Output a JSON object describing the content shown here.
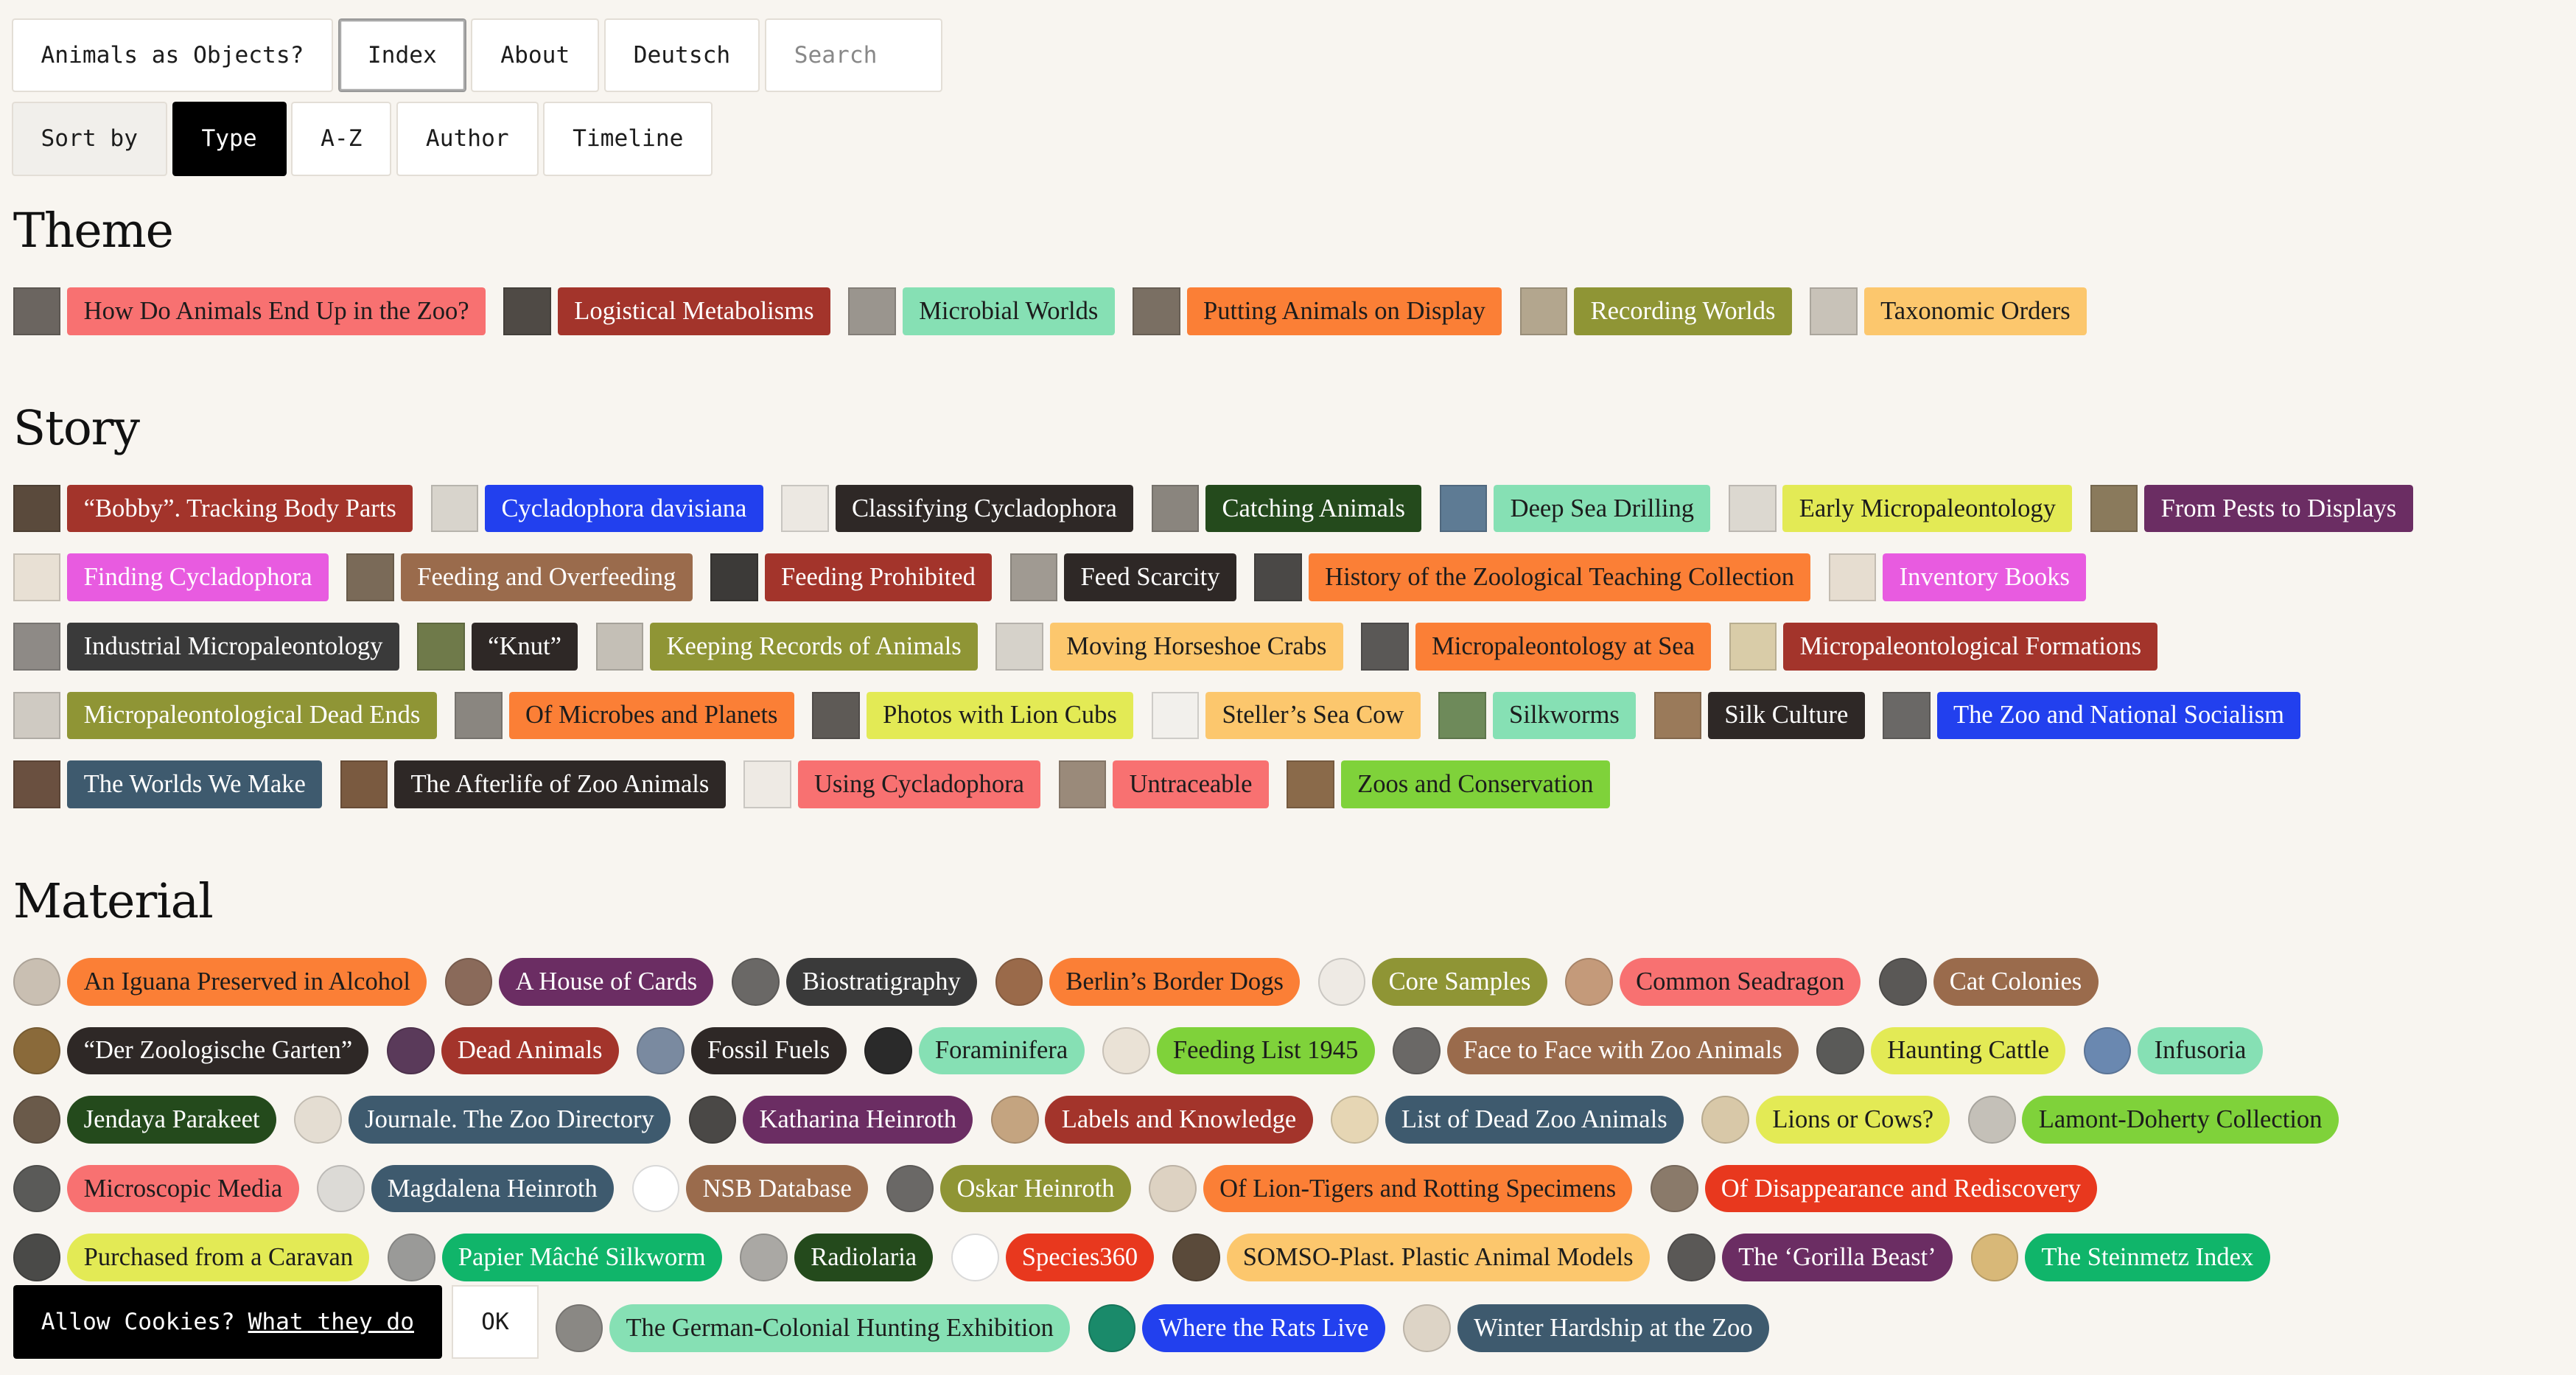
{
  "nav": {
    "home": "Animals as Objects?",
    "index": "Index",
    "about": "About",
    "lang": "Deutsch",
    "search_placeholder": "Search"
  },
  "sort": {
    "label": "Sort by",
    "options": [
      "Type",
      "A-Z",
      "Author",
      "Timeline"
    ],
    "selected": "Type"
  },
  "sections": [
    {
      "title": "Theme",
      "kind": "theme",
      "rows": [
        [
          {
            "label": "How Do Animals End Up in the Zoo?",
            "color": "#f87171",
            "thumb": "#6b6560"
          },
          {
            "label": "Logistical Metabolisms",
            "color": "#a3342b",
            "thumb": "#4f4a45"
          },
          {
            "label": "Microbial Worlds",
            "color": "#86e0b4",
            "thumb": "#9a958e"
          },
          {
            "label": "Putting Animals on Display",
            "color": "#fb7f36",
            "thumb": "#7a6f63"
          },
          {
            "label": "Recording Worlds",
            "color": "#8f9535",
            "thumb": "#b3a68e"
          },
          {
            "label": "Taxonomic Orders",
            "color": "#fcc76d",
            "thumb": "#c8c2b8"
          }
        ]
      ]
    },
    {
      "title": "Story",
      "kind": "story",
      "rows": [
        [
          {
            "label": "“Bobby”. Tracking Body Parts",
            "color": "#a3342b",
            "thumb": "#5a4a3c"
          },
          {
            "label": "Cycladophora davisiana",
            "color": "#2240ee",
            "thumb": "#d8d4cc"
          },
          {
            "label": "Classifying Cycladophora",
            "color": "#2e2826",
            "thumb": "#ece8e2"
          },
          {
            "label": "Catching Animals",
            "color": "#244a1c",
            "thumb": "#8a857e"
          },
          {
            "label": "Deep Sea Drilling",
            "color": "#86e0b4",
            "thumb": "#5e7b94"
          },
          {
            "label": "Early Micropaleontology",
            "color": "#e3ea55",
            "thumb": "#dcd8d0"
          },
          {
            "label": "From Pests to Displays",
            "color": "#6b2d63",
            "thumb": "#8a7a5c"
          }
        ],
        [
          {
            "label": "Finding Cycladophora",
            "color": "#e85be0",
            "thumb": "#e8e0d4"
          },
          {
            "label": "Feeding and Overfeeding",
            "color": "#9a6b4c",
            "thumb": "#7a6a58"
          },
          {
            "label": "Feeding Prohibited",
            "color": "#a3342b",
            "thumb": "#3c3a38"
          },
          {
            "label": "Feed Scarcity",
            "color": "#2e2826",
            "thumb": "#a09a92"
          },
          {
            "label": "History of the Zoological Teaching Collection",
            "color": "#fb7f36",
            "thumb": "#4a4846"
          },
          {
            "label": "Inventory Books",
            "color": "#e85be0",
            "thumb": "#e6ddd0"
          }
        ],
        [
          {
            "label": "Industrial Micropaleontology",
            "color": "#3a3a3a",
            "thumb": "#8e8a86"
          },
          {
            "label": "“Knut”",
            "color": "#2e2826",
            "thumb": "#6f7a4a"
          },
          {
            "label": "Keeping Records of Animals",
            "color": "#8f9535",
            "thumb": "#c4bfb6"
          },
          {
            "label": "Moving Horseshoe Crabs",
            "color": "#fcc76d",
            "thumb": "#d6d2ca"
          },
          {
            "label": "Micropaleontology at Sea",
            "color": "#fb7f36",
            "thumb": "#5a5856"
          },
          {
            "label": "Micropaleontological Formations",
            "color": "#a3342b",
            "thumb": "#d9cca8"
          }
        ],
        [
          {
            "label": "Micropaleontological Dead Ends",
            "color": "#8f9535",
            "thumb": "#cfcac2"
          },
          {
            "label": "Of Microbes and Planets",
            "color": "#fb7f36",
            "thumb": "#8a8680"
          },
          {
            "label": "Photos with Lion Cubs",
            "color": "#e3ea55",
            "thumb": "#5e5a56"
          },
          {
            "label": "Steller’s Sea Cow",
            "color": "#fcc76d",
            "thumb": "#f2f0ec"
          },
          {
            "label": "Silkworms",
            "color": "#86e0b4",
            "thumb": "#6e8a5a"
          },
          {
            "label": "Silk Culture",
            "color": "#2e2826",
            "thumb": "#9a7a5a"
          },
          {
            "label": "The Zoo and National Socialism",
            "color": "#2240ee",
            "thumb": "#6a6866"
          }
        ],
        [
          {
            "label": "The Worlds We Make",
            "color": "#3e5a6e",
            "thumb": "#6a5040"
          },
          {
            "label": "The Afterlife of Zoo Animals",
            "color": "#2e2826",
            "thumb": "#7a5a40"
          },
          {
            "label": "Using Cycladophora",
            "color": "#f87171",
            "thumb": "#eeeae4"
          },
          {
            "label": "Untraceable",
            "color": "#f87171",
            "thumb": "#9a8a7a"
          },
          {
            "label": "Zoos and Conservation",
            "color": "#7fd23a",
            "thumb": "#8a6a4a"
          }
        ]
      ]
    },
    {
      "title": "Material",
      "kind": "material",
      "rows": [
        [
          {
            "label": "An Iguana Preserved in Alcohol",
            "color": "#fb7f36",
            "thumb": "#c9bfb2"
          },
          {
            "label": "A House of Cards",
            "color": "#6b2d63",
            "thumb": "#8a6a5a"
          },
          {
            "label": "Biostratigraphy",
            "color": "#3a3a3a",
            "thumb": "#6a6866"
          },
          {
            "label": "Berlin’s Border Dogs",
            "color": "#fb7f36",
            "thumb": "#9a6a4a"
          },
          {
            "label": "Core Samples",
            "color": "#8f9535",
            "thumb": "#eeeae4"
          },
          {
            "label": "Common Seadragon",
            "color": "#f87171",
            "thumb": "#c49a7a"
          },
          {
            "label": "Cat Colonies",
            "color": "#9a6b4c",
            "thumb": "#5a5856"
          }
        ],
        [
          {
            "label": "“Der Zoologische Garten”",
            "color": "#2e2826",
            "thumb": "#8a6a3a"
          },
          {
            "label": "Dead Animals",
            "color": "#a3342b",
            "thumb": "#5a3a5a"
          },
          {
            "label": "Fossil Fuels",
            "color": "#2e2826",
            "thumb": "#7a8aa0"
          },
          {
            "label": "Foraminifera",
            "color": "#86e0b4",
            "thumb": "#2a2a2a"
          },
          {
            "label": "Feeding List 1945",
            "color": "#7fd23a",
            "thumb": "#eae2d6"
          },
          {
            "label": "Face to Face with Zoo Animals",
            "color": "#9a6b4c",
            "thumb": "#6a6866"
          },
          {
            "label": "Haunting Cattle",
            "color": "#e3ea55",
            "thumb": "#5a5a58"
          },
          {
            "label": "Infusoria",
            "color": "#86e0b4",
            "thumb": "#6a88b0"
          }
        ],
        [
          {
            "label": "Jendaya Parakeet",
            "color": "#244a1c",
            "thumb": "#6a5a4a"
          },
          {
            "label": "Journale. The Zoo Directory",
            "color": "#3e5a6e",
            "thumb": "#e4ddd2"
          },
          {
            "label": "Katharina Heinroth",
            "color": "#6b2d63",
            "thumb": "#4a4846"
          },
          {
            "label": "Labels and Knowledge",
            "color": "#a3342b",
            "thumb": "#c4a480"
          },
          {
            "label": "List of Dead Zoo Animals",
            "color": "#3e5a6e",
            "thumb": "#e6d6b4"
          },
          {
            "label": "Lions or Cows?",
            "color": "#e3ea55",
            "thumb": "#d8c8a8"
          },
          {
            "label": "Lamont-Doherty Collection",
            "color": "#7fd23a",
            "thumb": "#c4c0b8"
          }
        ],
        [
          {
            "label": "Microscopic Media",
            "color": "#f87171",
            "thumb": "#5a5a58"
          },
          {
            "label": "Magdalena Heinroth",
            "color": "#3e5a6e",
            "thumb": "#dcdad6"
          },
          {
            "label": "NSB Database",
            "color": "#9a6b4c",
            "thumb": "#ffffff"
          },
          {
            "label": "Oskar Heinroth",
            "color": "#8f9535",
            "thumb": "#6a6866"
          },
          {
            "label": "Of Lion-Tigers and Rotting Specimens",
            "color": "#fb7f36",
            "thumb": "#ddd2c2"
          },
          {
            "label": "Of Disappearance and Rediscovery",
            "color": "#e8381e",
            "thumb": "#8a7a6a"
          }
        ],
        [
          {
            "label": "Purchased from a Caravan",
            "color": "#e3ea55",
            "thumb": "#4a4a48"
          },
          {
            "label": "Papier Mâché Silkworm",
            "color": "#10b56a",
            "thumb": "#9a9a98"
          },
          {
            "label": "Radiolaria",
            "color": "#244a1c",
            "thumb": "#aaa8a4"
          },
          {
            "label": "Species360",
            "color": "#e8381e",
            "thumb": "#ffffff"
          },
          {
            "label": "SOMSO-Plast. Plastic Animal Models",
            "color": "#fcc76d",
            "thumb": "#5a4a3a"
          },
          {
            "label": "The ‘Gorilla Beast’",
            "color": "#6b2d63",
            "thumb": "#5a5856"
          },
          {
            "label": "The Steinmetz Index",
            "color": "#10b56a",
            "thumb": "#d8b878"
          }
        ],
        [
          {
            "label": "The German-Colonial Hunting Exhibition",
            "color": "#86e0b4",
            "thumb": "#8a8884"
          },
          {
            "label": "Where the Rats Live",
            "color": "#2240ee",
            "thumb": "#1a8a6a"
          },
          {
            "label": "Winter Hardship at the Zoo",
            "color": "#3e5a6e",
            "thumb": "#ddd4c6"
          }
        ]
      ]
    }
  ],
  "cookie": {
    "text": "Allow Cookies?",
    "link": "What they do",
    "ok": "OK"
  }
}
